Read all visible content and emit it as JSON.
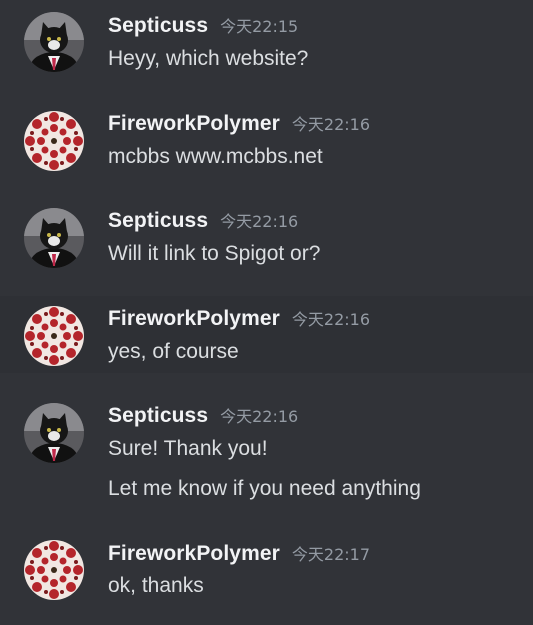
{
  "messages": [
    {
      "author": "Septicuss",
      "timestamp": "今天22:15",
      "avatar": "tuxedo-cat-avatar",
      "lines": [
        "Heyy, which website?"
      ]
    },
    {
      "author": "FireworkPolymer",
      "timestamp": "今天22:16",
      "avatar": "red-pattern-avatar",
      "lines": [
        "mcbbs www.mcbbs.net"
      ]
    },
    {
      "author": "Septicuss",
      "timestamp": "今天22:16",
      "avatar": "tuxedo-cat-avatar",
      "lines": [
        "Will it link to Spigot or?"
      ]
    },
    {
      "author": "FireworkPolymer",
      "timestamp": "今天22:16",
      "avatar": "red-pattern-avatar",
      "lines": [
        "yes, of course"
      ]
    },
    {
      "author": "Septicuss",
      "timestamp": "今天22:16",
      "avatar": "tuxedo-cat-avatar",
      "lines": [
        "Sure! Thank you!",
        "Let me know if you need anything"
      ]
    },
    {
      "author": "FireworkPolymer",
      "timestamp": "今天22:17",
      "avatar": "red-pattern-avatar",
      "lines": [
        "ok, thanks"
      ]
    }
  ],
  "colors": {
    "background": "#313338",
    "hover_background": "#2e3035",
    "username": "#f2f3f5",
    "message_text": "#dbdee1",
    "timestamp": "#949ba4"
  }
}
